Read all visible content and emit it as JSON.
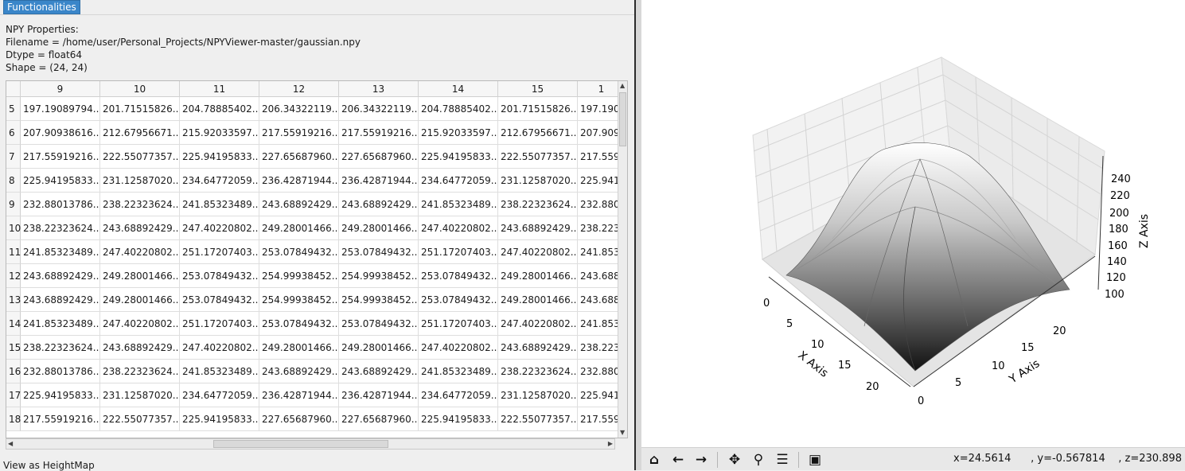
{
  "menu": {
    "functionalities": "Functionalities"
  },
  "properties": {
    "heading": "NPY Properties:",
    "filename": "Filename = /home/user/Personal_Projects/NPYViewer-master/gaussian.npy",
    "dtype": "Dtype = float64",
    "shape": "Shape = (24, 24)"
  },
  "table": {
    "columns": [
      "9",
      "10",
      "11",
      "12",
      "13",
      "14",
      "15",
      "1"
    ],
    "rows": [
      {
        "label": "5",
        "cells": [
          "197.19089794...",
          "201.71515826...",
          "204.78885402...",
          "206.34322119...",
          "206.34322119...",
          "204.78885402...",
          "201.71515826...",
          "197.190"
        ]
      },
      {
        "label": "6",
        "cells": [
          "207.90938616...",
          "212.67956671...",
          "215.92033597...",
          "217.55919216...",
          "217.55919216...",
          "215.92033597...",
          "212.67956671...",
          "207.909"
        ]
      },
      {
        "label": "7",
        "cells": [
          "217.55919216...",
          "222.55077357...",
          "225.94195833...",
          "227.65687960...",
          "227.65687960...",
          "225.94195833...",
          "222.55077357...",
          "217.559"
        ]
      },
      {
        "label": "8",
        "cells": [
          "225.94195833...",
          "231.12587020...",
          "234.64772059...",
          "236.42871944...",
          "236.42871944...",
          "234.64772059...",
          "231.12587020...",
          "225.941"
        ]
      },
      {
        "label": "9",
        "cells": [
          "232.88013786...",
          "238.22323624...",
          "241.85323489...",
          "243.68892429...",
          "243.68892429...",
          "241.85323489...",
          "238.22323624...",
          "232.880"
        ]
      },
      {
        "label": "10",
        "cells": [
          "238.22323624...",
          "243.68892429...",
          "247.40220802...",
          "249.28001466...",
          "249.28001466...",
          "247.40220802...",
          "243.68892429...",
          "238.223"
        ]
      },
      {
        "label": "11",
        "cells": [
          "241.85323489...",
          "247.40220802...",
          "251.17207403...",
          "253.07849432...",
          "253.07849432...",
          "251.17207403...",
          "247.40220802...",
          "241.853"
        ]
      },
      {
        "label": "12",
        "cells": [
          "243.68892429...",
          "249.28001466...",
          "253.07849432...",
          "254.99938452...",
          "254.99938452...",
          "253.07849432...",
          "249.28001466...",
          "243.688"
        ]
      },
      {
        "label": "13",
        "cells": [
          "243.68892429...",
          "249.28001466...",
          "253.07849432...",
          "254.99938452...",
          "254.99938452...",
          "253.07849432...",
          "249.28001466...",
          "243.688"
        ]
      },
      {
        "label": "14",
        "cells": [
          "241.85323489...",
          "247.40220802...",
          "251.17207403...",
          "253.07849432...",
          "253.07849432...",
          "251.17207403...",
          "247.40220802...",
          "241.853"
        ]
      },
      {
        "label": "15",
        "cells": [
          "238.22323624...",
          "243.68892429...",
          "247.40220802...",
          "249.28001466...",
          "249.28001466...",
          "247.40220802...",
          "243.68892429...",
          "238.223"
        ]
      },
      {
        "label": "16",
        "cells": [
          "232.88013786...",
          "238.22323624...",
          "241.85323489...",
          "243.68892429...",
          "243.68892429...",
          "241.85323489...",
          "238.22323624...",
          "232.880"
        ]
      },
      {
        "label": "17",
        "cells": [
          "225.94195833...",
          "231.12587020...",
          "234.64772059...",
          "236.42871944...",
          "236.42871944...",
          "234.64772059...",
          "231.12587020...",
          "225.941"
        ]
      },
      {
        "label": "18",
        "cells": [
          "217.55919216...",
          "222.55077357...",
          "225.94195833...",
          "227.65687960...",
          "227.65687960...",
          "225.94195833...",
          "222.55077357...",
          "217.559"
        ]
      }
    ]
  },
  "heightmap_button": "View as HeightMap",
  "plot": {
    "x_axis_label": "X Axis",
    "y_axis_label": "Y Axis",
    "z_axis_label": "Z Axis",
    "x_ticks": [
      "0",
      "5",
      "10",
      "15",
      "20"
    ],
    "y_ticks": [
      "0",
      "5",
      "10",
      "15",
      "20"
    ],
    "z_ticks": [
      "100",
      "120",
      "140",
      "160",
      "180",
      "200",
      "220",
      "240"
    ]
  },
  "toolbar": {
    "buttons": [
      "home-icon",
      "back-icon",
      "forward-icon",
      "pan-icon",
      "zoom-icon",
      "configure-icon",
      "save-icon"
    ],
    "coordinates": "x=24.5614      , y=-0.567814    , z=230.898"
  }
}
